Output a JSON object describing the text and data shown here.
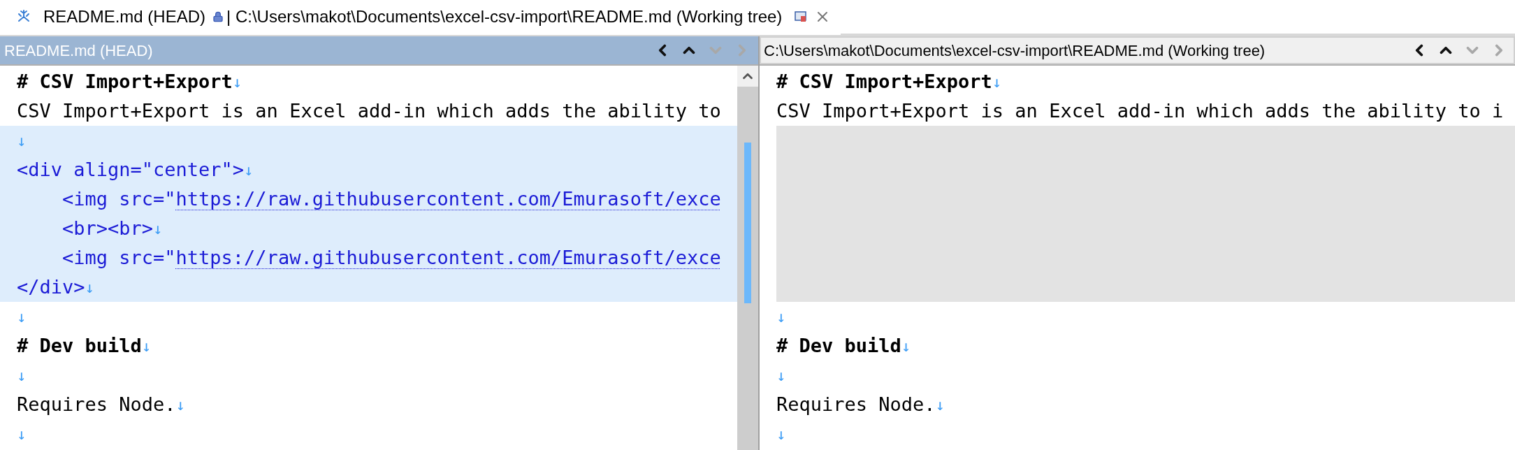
{
  "tab": {
    "title": "README.md (HEAD)",
    "locked": true,
    "path": "| C:\\Users\\makot\\Documents\\excel-csv-import\\README.md (Working tree)"
  },
  "panes": [
    {
      "title": "README.md (HEAD)",
      "selected": true,
      "scrollbar": true,
      "nav": [
        {
          "kind": "prev",
          "disabled": false
        },
        {
          "kind": "up",
          "disabled": false
        },
        {
          "kind": "down",
          "disabled": true
        },
        {
          "kind": "next",
          "disabled": true
        }
      ],
      "lines": [
        {
          "kind": "line",
          "changed": false,
          "segments": [
            {
              "kind": "heading",
              "text": "# CSV Import+Export"
            }
          ],
          "eol": "↓"
        },
        {
          "kind": "line",
          "changed": false,
          "segments": [
            {
              "kind": "plain",
              "text": "CSV Import+Export is an Excel add-in which adds the ability to"
            }
          ]
        },
        {
          "kind": "line",
          "changed": true,
          "eol": "↓"
        },
        {
          "kind": "line",
          "changed": true,
          "segments": [
            {
              "kind": "tag",
              "text": "<div align=\"center\">"
            }
          ],
          "eol": "↓"
        },
        {
          "kind": "line",
          "changed": true,
          "segments": [
            {
              "kind": "tag",
              "text": "    <img src=\""
            },
            {
              "kind": "link",
              "text": "https://raw.githubusercontent.com/Emurasoft/exce"
            }
          ]
        },
        {
          "kind": "line",
          "changed": true,
          "segments": [
            {
              "kind": "tag",
              "text": "    <br><br>"
            }
          ],
          "eol": "↓"
        },
        {
          "kind": "line",
          "changed": true,
          "segments": [
            {
              "kind": "tag",
              "text": "    <img src=\""
            },
            {
              "kind": "link",
              "text": "https://raw.githubusercontent.com/Emurasoft/exce"
            }
          ]
        },
        {
          "kind": "line",
          "changed": true,
          "segments": [
            {
              "kind": "tag",
              "text": "</div>"
            }
          ],
          "eol": "↓"
        },
        {
          "kind": "line",
          "changed": false,
          "eol": "↓"
        },
        {
          "kind": "line",
          "changed": false,
          "segments": [
            {
              "kind": "heading",
              "text": "# Dev build"
            }
          ],
          "eol": "↓"
        },
        {
          "kind": "line",
          "changed": false,
          "eol": "↓"
        },
        {
          "kind": "line",
          "changed": false,
          "segments": [
            {
              "kind": "plain",
              "text": "Requires Node."
            }
          ],
          "eol": "↓"
        },
        {
          "kind": "line",
          "changed": false,
          "eol": "↓"
        }
      ]
    },
    {
      "title": "C:\\Users\\makot\\Documents\\excel-csv-import\\README.md (Working tree)",
      "selected": false,
      "scrollbar": false,
      "nav": [
        {
          "kind": "prev",
          "disabled": false
        },
        {
          "kind": "up",
          "disabled": false
        },
        {
          "kind": "down",
          "disabled": true
        },
        {
          "kind": "next",
          "disabled": true
        }
      ],
      "lines": [
        {
          "kind": "line",
          "changed": false,
          "segments": [
            {
              "kind": "heading",
              "text": "# CSV Import+Export"
            }
          ],
          "eol": "↓"
        },
        {
          "kind": "line",
          "changed": false,
          "segments": [
            {
              "kind": "plain",
              "text": "CSV Import+Export is an Excel add-in which adds the ability to i"
            }
          ]
        },
        {
          "kind": "gap"
        },
        {
          "kind": "gap"
        },
        {
          "kind": "gap"
        },
        {
          "kind": "gap"
        },
        {
          "kind": "gap"
        },
        {
          "kind": "gap"
        },
        {
          "kind": "line",
          "changed": false,
          "eol": "↓"
        },
        {
          "kind": "line",
          "changed": false,
          "segments": [
            {
              "kind": "heading",
              "text": "# Dev build"
            }
          ],
          "eol": "↓"
        },
        {
          "kind": "line",
          "changed": false,
          "eol": "↓"
        },
        {
          "kind": "line",
          "changed": false,
          "segments": [
            {
              "kind": "plain",
              "text": "Requires Node."
            }
          ],
          "eol": "↓"
        },
        {
          "kind": "line",
          "changed": false,
          "eol": "↓"
        }
      ]
    }
  ]
}
